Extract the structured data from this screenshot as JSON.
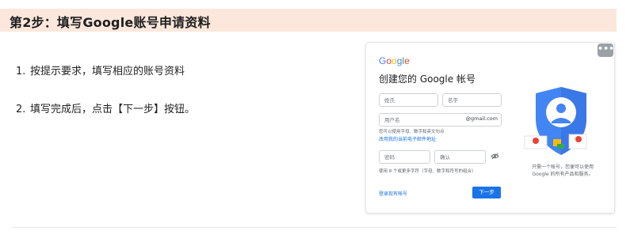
{
  "header": {
    "title": "第2步：填写Google账号申请资料"
  },
  "steps": [
    {
      "num": "1.",
      "text": "按提示要求，填写相应的账号资料"
    },
    {
      "num": "2.",
      "text": "填写完成后，点击【下一步】按钮。"
    }
  ],
  "card": {
    "more_label": "•••",
    "logo": {
      "letters": [
        "G",
        "o",
        "o",
        "g",
        "l",
        "e"
      ],
      "colors": [
        "#4285F4",
        "#EA4335",
        "#FBBC05",
        "#4285F4",
        "#34A853",
        "#EA4335"
      ]
    },
    "title": "创建您的 Google 帐号",
    "last_name_placeholder": "姓氏",
    "first_name_placeholder": "名字",
    "username_placeholder": "用户名",
    "username_suffix": "@gmail.com",
    "username_hint": "您可以使用字母、数字和英文句点",
    "use_current_email_link": "改用我的当前电子邮件地址",
    "password_placeholder": "密码",
    "confirm_placeholder": "确认",
    "password_hint": "使用 8 个或更多字符（字母、数字和符号的组合）",
    "sign_in_link": "登录现有帐号",
    "next_button": "下一步",
    "caption_line1": "只需一个帐号，您便可以使用",
    "caption_line2": "Google 的所有产品和服务。",
    "accent_color": "#1a73e8"
  }
}
